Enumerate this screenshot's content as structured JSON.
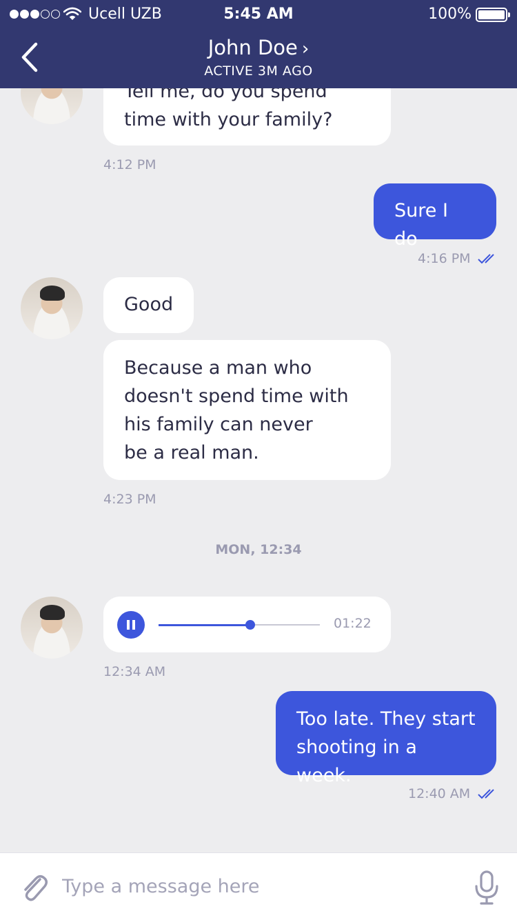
{
  "status_bar": {
    "carrier": "Ucell UZB",
    "time": "5:45 AM",
    "battery": "100%",
    "icons": [
      "signal-icon",
      "wifi-icon",
      "battery-icon"
    ]
  },
  "header": {
    "contact_name": "John Doe",
    "chevron": "›",
    "status": "ACTIVE 3M AGO",
    "icons": [
      "back-chevron-icon"
    ]
  },
  "messages": [
    {
      "from": "them",
      "text": "Tell me, do you spend time with your family?",
      "lines": [
        "Tell me, do you spend",
        "time with your family?"
      ],
      "time": "4:12 PM"
    },
    {
      "from": "me",
      "text": "Sure I do",
      "time": "4:16 PM",
      "read": true
    },
    {
      "from": "them",
      "text": "Good"
    },
    {
      "from": "them",
      "lines": [
        "Because a man who",
        "doesn't spend time with",
        "his family can never",
        "be a real man."
      ],
      "time": "4:23 PM"
    },
    {
      "from": "me",
      "lines": [
        "Too late. They start",
        "shooting in a week."
      ],
      "time": "12:40 AM",
      "read": true
    }
  ],
  "date_divider": "MON, 12:34",
  "voice_message": {
    "duration": "01:22",
    "progress": 0.57,
    "time": "12:34 AM",
    "icons": [
      "pause-icon"
    ]
  },
  "composer": {
    "placeholder": "Type a message here",
    "icons": [
      "paperclip-icon",
      "microphone-icon"
    ]
  },
  "colors": {
    "header_bg": "#323870",
    "accent": "#3d56dc",
    "chat_bg": "#ededef",
    "muted_text": "#9a9ab0"
  }
}
